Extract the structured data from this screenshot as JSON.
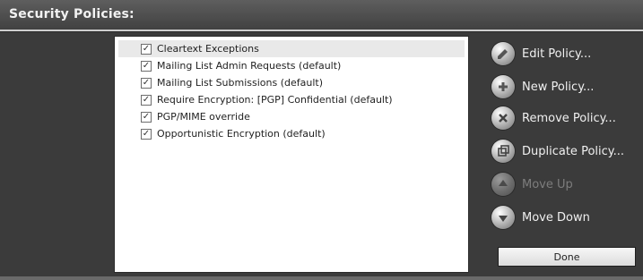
{
  "window": {
    "title": "Security Policies:"
  },
  "policies": [
    {
      "label": "Cleartext Exceptions",
      "checked": true,
      "selected": true
    },
    {
      "label": "Mailing List Admin Requests (default)",
      "checked": true,
      "selected": false
    },
    {
      "label": "Mailing List Submissions (default)",
      "checked": true,
      "selected": false
    },
    {
      "label": "Require Encryption: [PGP] Confidential (default)",
      "checked": true,
      "selected": false
    },
    {
      "label": "PGP/MIME override",
      "checked": true,
      "selected": false
    },
    {
      "label": "Opportunistic Encryption (default)",
      "checked": true,
      "selected": false
    }
  ],
  "checkmark": "✓",
  "actions": {
    "edit": {
      "label": "Edit Policy...",
      "icon": "pencil-icon",
      "enabled": true
    },
    "new": {
      "label": "New Policy...",
      "icon": "plus-icon",
      "enabled": true
    },
    "remove": {
      "label": "Remove Policy...",
      "icon": "x-icon",
      "enabled": true
    },
    "duplicate": {
      "label": "Duplicate Policy...",
      "icon": "duplicate-icon",
      "enabled": true
    },
    "move_up": {
      "label": "Move Up",
      "icon": "arrow-up-icon",
      "enabled": false
    },
    "move_down": {
      "label": "Move Down",
      "icon": "arrow-down-icon",
      "enabled": true
    }
  },
  "done_label": "Done"
}
